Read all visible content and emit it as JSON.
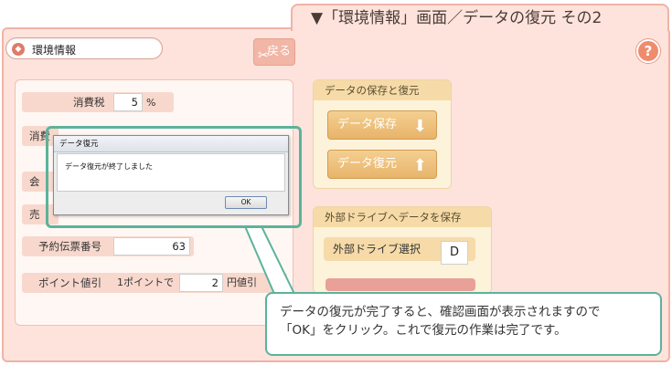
{
  "caption": {
    "text": "▼「環境情報」画面／データの復元 その2"
  },
  "header": {
    "title": "環境情報",
    "back_label": "戻る",
    "help_label": "?"
  },
  "left_form": {
    "tax_label": "消費税",
    "tax_value": "5",
    "tax_unit": "%",
    "row2_label": "消費",
    "row3_label": "会",
    "row4_label": "売",
    "order_label": "予約伝票番号",
    "order_value": "63",
    "point_label": "ポイント値引",
    "point_per": "1ポイントで",
    "point_value": "2",
    "point_unit": "円値引"
  },
  "data_box": {
    "title": "データの保存と復元",
    "save_label": "データ保存",
    "restore_label": "データ復元"
  },
  "external_box": {
    "title": "外部ドライブへデータを保存",
    "drive_label": "外部ドライブ選択",
    "drive_value": "D"
  },
  "dialog": {
    "title": "データ復元",
    "message": "データ復元が終了しました",
    "ok_label": "OK"
  },
  "callout": {
    "line1": "データの復元が完了すると、確認画面が表示されますので",
    "line2": "「OK」をクリック。これで復元の作業は完了です。"
  },
  "colors": {
    "accent_green": "#5bb39a",
    "frame_pink": "#fde3dc",
    "orange_button": "#e8b46a"
  }
}
